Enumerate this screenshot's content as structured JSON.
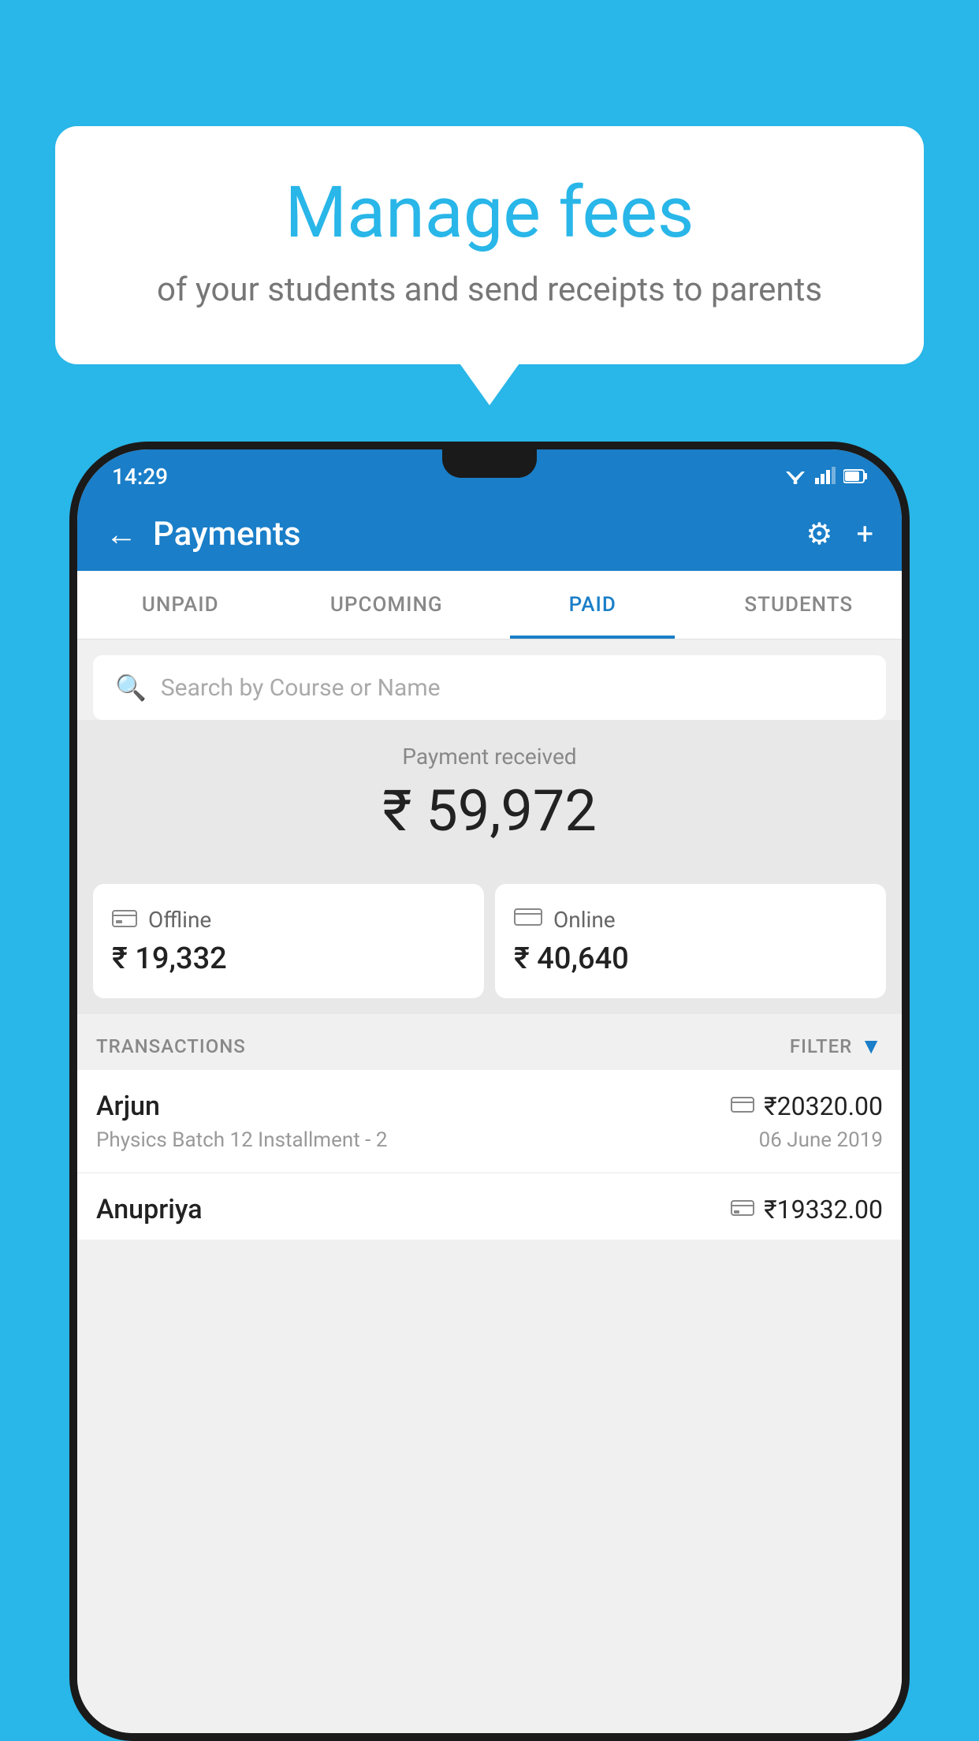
{
  "background_color": "#29b6e8",
  "bubble": {
    "title": "Manage fees",
    "subtitle": "of your students and send receipts to parents"
  },
  "status_bar": {
    "time": "14:29",
    "wifi": "▼",
    "signal": "▲",
    "battery": "▮"
  },
  "app_bar": {
    "title": "Payments",
    "back_label": "←",
    "gear_label": "⚙",
    "plus_label": "+"
  },
  "tabs": [
    {
      "label": "UNPAID",
      "active": false
    },
    {
      "label": "UPCOMING",
      "active": false
    },
    {
      "label": "PAID",
      "active": true
    },
    {
      "label": "STUDENTS",
      "active": false
    }
  ],
  "search": {
    "placeholder": "Search by Course or Name"
  },
  "payment_received": {
    "label": "Payment received",
    "amount": "₹ 59,972"
  },
  "payment_cards": [
    {
      "type": "Offline",
      "amount": "₹ 19,332",
      "icon": "offline"
    },
    {
      "type": "Online",
      "amount": "₹ 40,640",
      "icon": "online"
    }
  ],
  "transactions_header": {
    "label": "TRANSACTIONS",
    "filter_label": "FILTER"
  },
  "transactions": [
    {
      "name": "Arjun",
      "detail": "Physics Batch 12 Installment - 2",
      "amount": "₹20320.00",
      "date": "06 June 2019",
      "payment_type": "online"
    },
    {
      "name": "Anupriya",
      "detail": "",
      "amount": "₹19332.00",
      "date": "",
      "payment_type": "offline"
    }
  ]
}
